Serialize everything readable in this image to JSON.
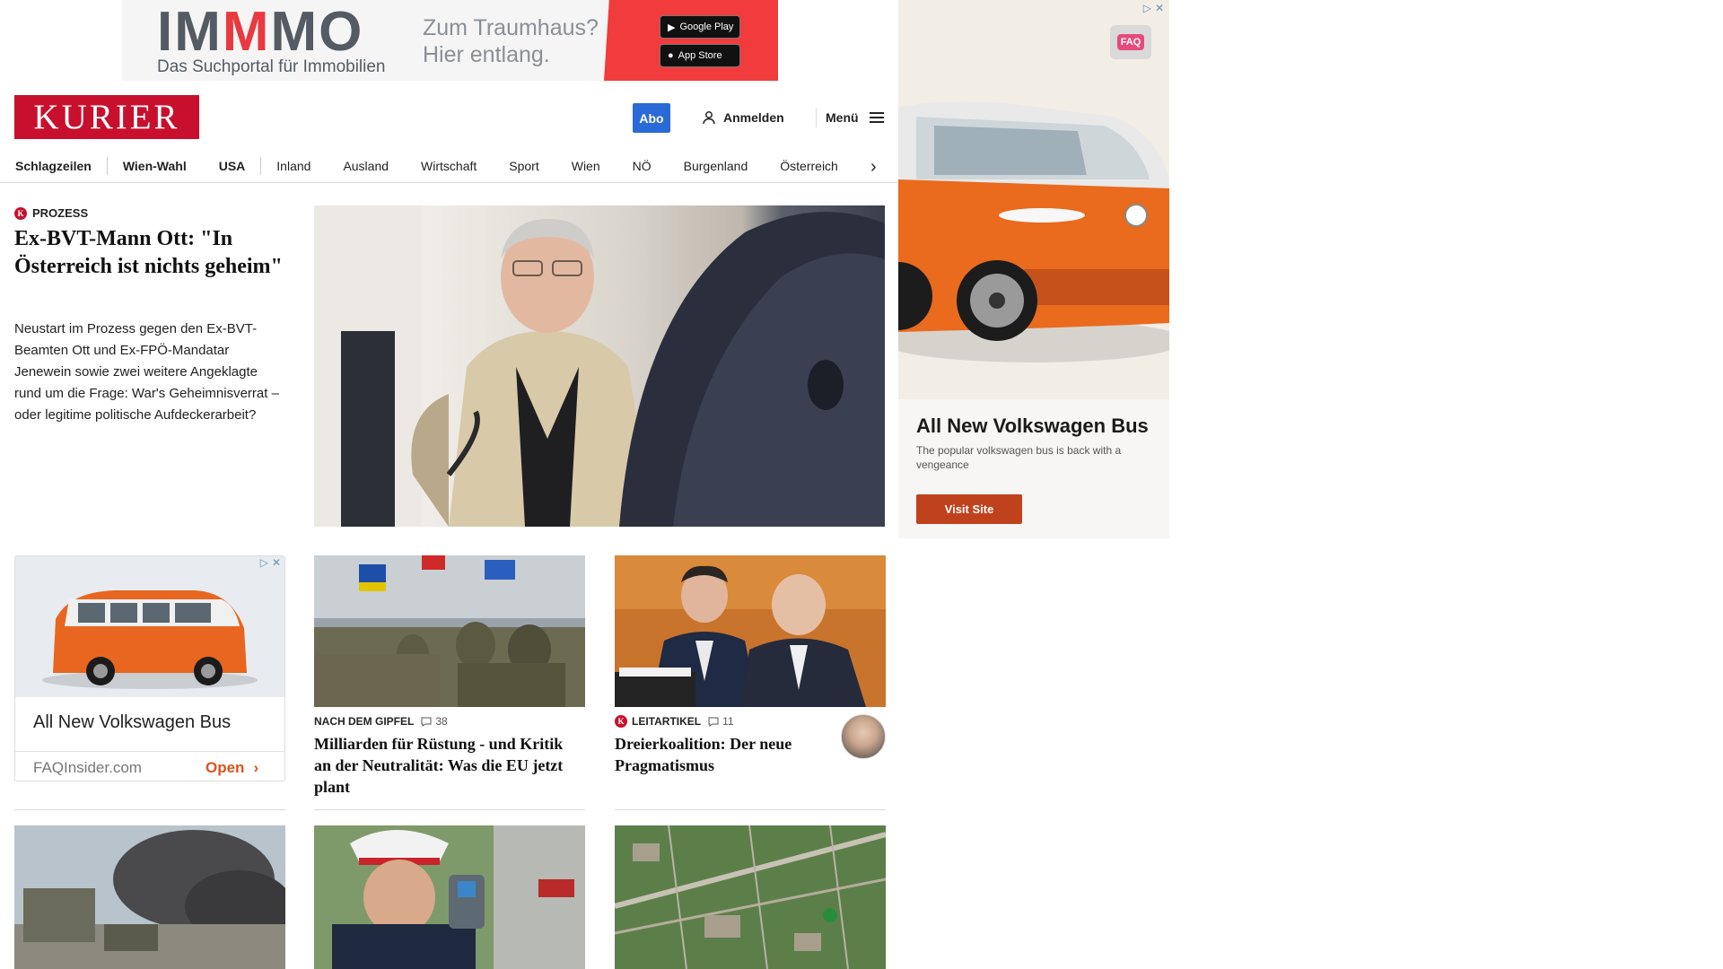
{
  "top_ad": {
    "brand_prefix": "IM",
    "brand_highlight": "M",
    "brand_suffix": "MO",
    "tagline": "Das Suchportal für Immobilien",
    "slogan_line1": "Zum Traumhaus?",
    "slogan_line2": "Hier entlang.",
    "google_play": "Google Play",
    "app_store": "App Store"
  },
  "header": {
    "logo": "KURIER",
    "abo": "Abo",
    "login": "Anmelden",
    "menu": "Menü"
  },
  "nav": {
    "items": [
      "Schlagzeilen",
      "Wien-Wahl",
      "USA",
      "Inland",
      "Ausland",
      "Wirtschaft",
      "Sport",
      "Wien",
      "NÖ",
      "Burgenland",
      "Österreich"
    ]
  },
  "lead": {
    "kicker": "PROZESS",
    "title": "Ex-BVT-Mann Ott: \"In Österreich ist nichts geheim\"",
    "teaser": "Neustart im Prozess gegen den Ex-BVT-Beamten Ott und Ex-FPÖ-Mandatar Jenewein sowie zwei weitere Angeklagte rund um die Frage: War's Geheimnisverrat – oder legitime politische Aufdeckerarbeit?"
  },
  "side_ad": {
    "title": "All New Volkswagen Bus",
    "description": "The popular volkswagen bus is back with a vengeance",
    "cta": "Visit Site",
    "badge": "FAQ"
  },
  "card_ad": {
    "title": "All New Volkswagen Bus",
    "site": "FAQInsider.com",
    "cta": "Open"
  },
  "cards": [
    {
      "kicker": "NACH DEM GIPFEL",
      "comments": "38",
      "title": "Milliarden für Rüstung - und Kritik an der Neutralität: Was die EU jetzt plant"
    },
    {
      "kicker": "LEITARTIKEL",
      "comments": "11",
      "title": "Dreierkoalition: Der neue Pragmatismus"
    }
  ],
  "colors": {
    "brand_red": "#c8102e",
    "abo_blue": "#2a6ad8",
    "ad_cta": "#c0421c"
  }
}
